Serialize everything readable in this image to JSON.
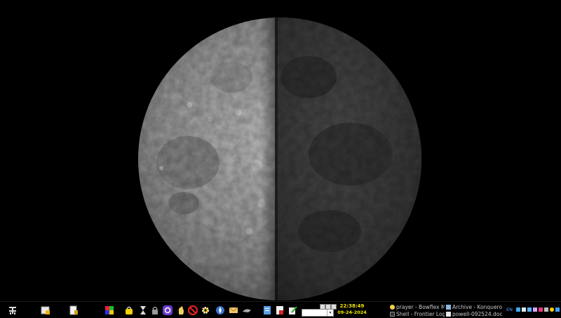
{
  "panel": {
    "launchers": [
      {
        "name": "kde-menu-icon"
      },
      {
        "name": "show-desktop-icon"
      },
      {
        "name": "notes-icon"
      },
      {
        "name": "color-grid-icon"
      },
      {
        "name": "lock-bag-icon"
      },
      {
        "name": "hourglass-icon"
      },
      {
        "name": "padlock-icon"
      },
      {
        "name": "purple-app-icon"
      },
      {
        "name": "chess-icon"
      },
      {
        "name": "no-entry-icon"
      },
      {
        "name": "gear-cog-icon"
      },
      {
        "name": "compass-icon"
      },
      {
        "name": "mail-icon"
      },
      {
        "name": "terminal-bird-icon"
      },
      {
        "name": "document-icon"
      },
      {
        "name": "pdf-icon"
      },
      {
        "name": "edit-pencil-icon"
      }
    ],
    "clock": {
      "time": "22:38:49",
      "date": "09-24-2024"
    },
    "tasks": [
      {
        "label": "prayer - Bowflex M"
      },
      {
        "label": "Archive - Konqueror"
      },
      {
        "label": "Shell - Frontier Log"
      },
      {
        "label": "powell-092524.doc"
      }
    ],
    "tray": {
      "lang": "EN"
    }
  }
}
